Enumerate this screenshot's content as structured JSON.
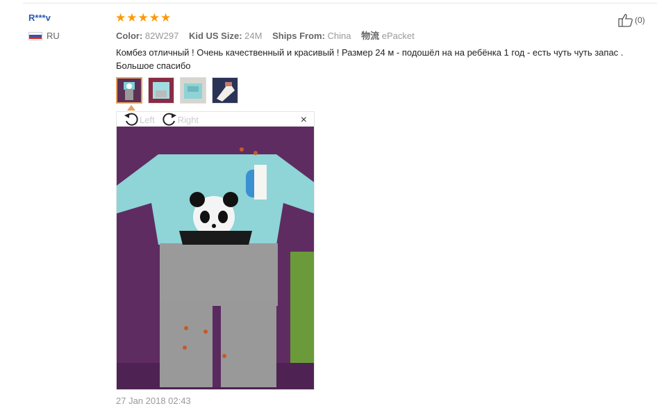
{
  "review": {
    "user_name": "R***v",
    "country_code": "RU",
    "rating": 5,
    "attributes": [
      {
        "key": "Color:",
        "value": "82W297"
      },
      {
        "key": "Kid US Size:",
        "value": "24M"
      },
      {
        "key": "Ships From:",
        "value": "China"
      },
      {
        "key": "物流",
        "value": "ePacket"
      }
    ],
    "text": "Комбез отличный ! Очень качественный и красивый ! Размер 24 м - подошёл на на ребёнка 1 год - есть чуть чуть запас . Большое спасибо",
    "helpful_count": "(0)",
    "date": "27 Jan 2018 02:43"
  },
  "viewer": {
    "rotate_left_label": "Left",
    "rotate_right_label": "Right",
    "close_glyph": "×"
  },
  "colors": {
    "star": "#ff9900",
    "user_link": "#2a5db0",
    "thumb_active_border": "#e5a05f"
  }
}
